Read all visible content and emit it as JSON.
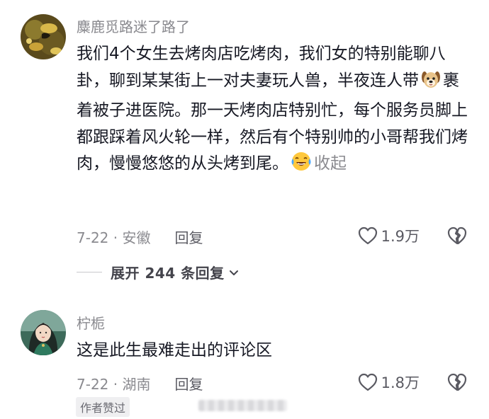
{
  "comments": [
    {
      "username": "麋鹿觅路迷了路了",
      "content_part1": "我们4个女生去烤肉店吃烤肉，我们女的特别能聊八卦，聊到某某街上一对夫妻玩人兽，半夜连人带",
      "content_part2": "裹着被子进医院。那一天烤肉店特别忙，每个服务员脚上都跟踩着风火轮一样，然后有个特别帅的小哥帮我们烤肉，慢慢悠悠的从头烤到尾。",
      "emoji1_icon": "dog-face-emoji",
      "emoji2_icon": "laughing-crying-emoji",
      "collapse_label": "收起",
      "date_location": "7-22 · 安徽",
      "reply_label": "回复",
      "like_count": "1.9万",
      "expand_label": "展开 244 条回复"
    },
    {
      "username": "柠栀",
      "content": "这是此生最难走出的评论区",
      "date_location": "7-22 · 湖南",
      "reply_label": "回复",
      "like_count": "1.8万",
      "author_badge": "作者赞过"
    }
  ],
  "colors": {
    "primary_text": "#161823",
    "secondary_text": "#8a8a8f"
  }
}
